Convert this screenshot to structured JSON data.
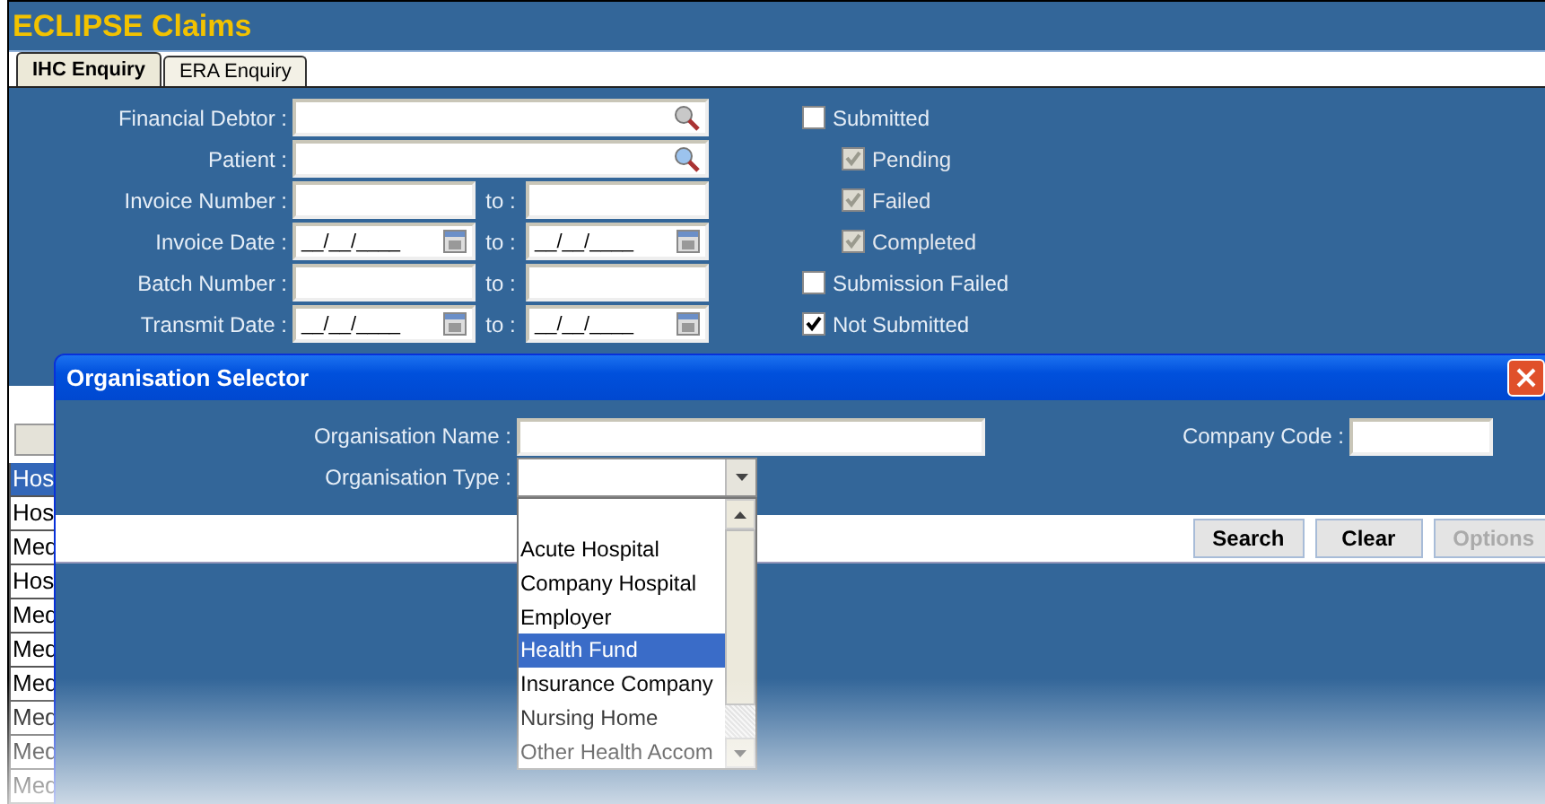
{
  "app_title": "ECLIPSE Claims",
  "tabs": [
    {
      "label": "IHC Enquiry",
      "selected": true
    },
    {
      "label": "ERA Enquiry",
      "selected": false
    }
  ],
  "filters": [
    {
      "label": "Financial Debtor :",
      "kind": "search"
    },
    {
      "label": "Patient :",
      "kind": "search"
    },
    {
      "label": "Invoice Number :",
      "kind": "range",
      "to_label": "to :"
    },
    {
      "label": "Invoice Date :",
      "kind": "date_range",
      "to_label": "to :",
      "value": "__/__/____",
      "to_value": "__/__/____"
    },
    {
      "label": "Batch Number :",
      "kind": "range",
      "to_label": "to :"
    },
    {
      "label": "Transmit Date :",
      "kind": "date_range",
      "to_label": "to :",
      "value": "__/__/____",
      "to_value": "__/__/____"
    }
  ],
  "status_checks": [
    {
      "label": "Submitted",
      "checked": false,
      "disabled": false,
      "children": [
        {
          "label": "Pending",
          "checked": true,
          "disabled": true
        },
        {
          "label": "Failed",
          "checked": true,
          "disabled": true
        },
        {
          "label": "Completed",
          "checked": true,
          "disabled": true
        }
      ]
    },
    {
      "label": "Submission Failed",
      "checked": false,
      "disabled": false
    },
    {
      "label": "Not Submitted",
      "checked": true,
      "disabled": false
    }
  ],
  "results_rows": [
    {
      "column_1": "Hos",
      "selected": true
    },
    {
      "column_1": "Hos",
      "selected": false
    },
    {
      "column_1": "Med",
      "selected": false
    },
    {
      "column_1": "Hos",
      "selected": false
    },
    {
      "column_1": "Med",
      "selected": false
    },
    {
      "column_1": "Med",
      "selected": false
    },
    {
      "column_1": "Med",
      "selected": false
    },
    {
      "column_1": "Med",
      "selected": false
    },
    {
      "column_1": "Med",
      "selected": false
    },
    {
      "column_1": "Med",
      "selected": false
    }
  ],
  "dialog": {
    "title": "Organisation Selector",
    "name_label": "Organisation Name :",
    "code_label": "Company Code :",
    "type_label": "Organisation Type :",
    "type_options": [
      {
        "label": "Acute Hospital",
        "selected": false
      },
      {
        "label": "Company Hospital",
        "selected": false
      },
      {
        "label": "Employer",
        "selected": false
      },
      {
        "label": "Health Fund",
        "selected": true
      },
      {
        "label": "Insurance Company",
        "selected": false
      },
      {
        "label": "Nursing Home",
        "selected": false
      },
      {
        "label": "Other Health Accom",
        "selected": false
      }
    ],
    "buttons": [
      {
        "label": "Search",
        "disabled": false
      },
      {
        "label": "Clear",
        "disabled": false
      },
      {
        "label": "Options",
        "disabled": true
      }
    ]
  }
}
